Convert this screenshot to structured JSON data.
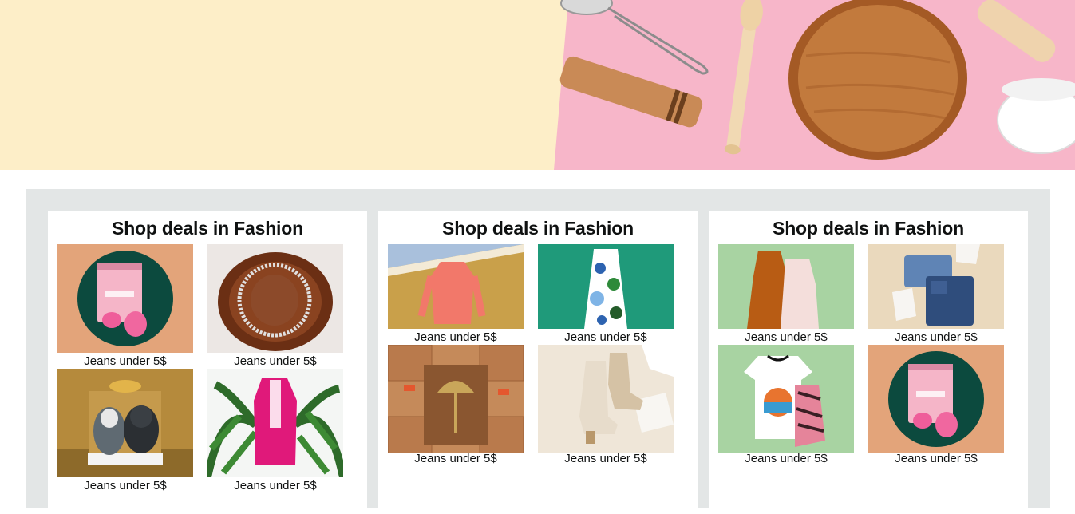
{
  "hero": {
    "left_color": "#fdeec8",
    "right_color": "#f7b6c9"
  },
  "cards": [
    {
      "title": "Shop deals in Fashion",
      "tiles": [
        {
          "caption": "Jeans under 5$",
          "image": "makeup-blender-product"
        },
        {
          "caption": "Jeans under 5$",
          "image": "necklace-on-fur"
        },
        {
          "caption": "Jeans under 5$",
          "image": "plush-toys-gift-box"
        },
        {
          "caption": "Jeans under 5$",
          "image": "pink-cardigan-plant"
        }
      ]
    },
    {
      "title": "Shop deals in Fashion",
      "tiles": [
        {
          "caption": "Jeans under 5$",
          "image": "orange-sweater-hanger"
        },
        {
          "caption": "Jeans under 5$",
          "image": "floral-dress-teal"
        },
        {
          "caption": "Jeans under 5$",
          "image": "lamp-in-boxes"
        },
        {
          "caption": "Jeans under 5$",
          "image": "beige-boots"
        }
      ]
    },
    {
      "title": "Shop deals in Fashion",
      "tiles": [
        {
          "caption": "Jeans under 5$",
          "image": "slip-dresses"
        },
        {
          "caption": "Jeans under 5$",
          "image": "folded-jeans"
        },
        {
          "caption": "Jeans under 5$",
          "image": "graphic-tee-tank"
        },
        {
          "caption": "Jeans under 5$",
          "image": "makeup-blender-product"
        }
      ]
    }
  ]
}
